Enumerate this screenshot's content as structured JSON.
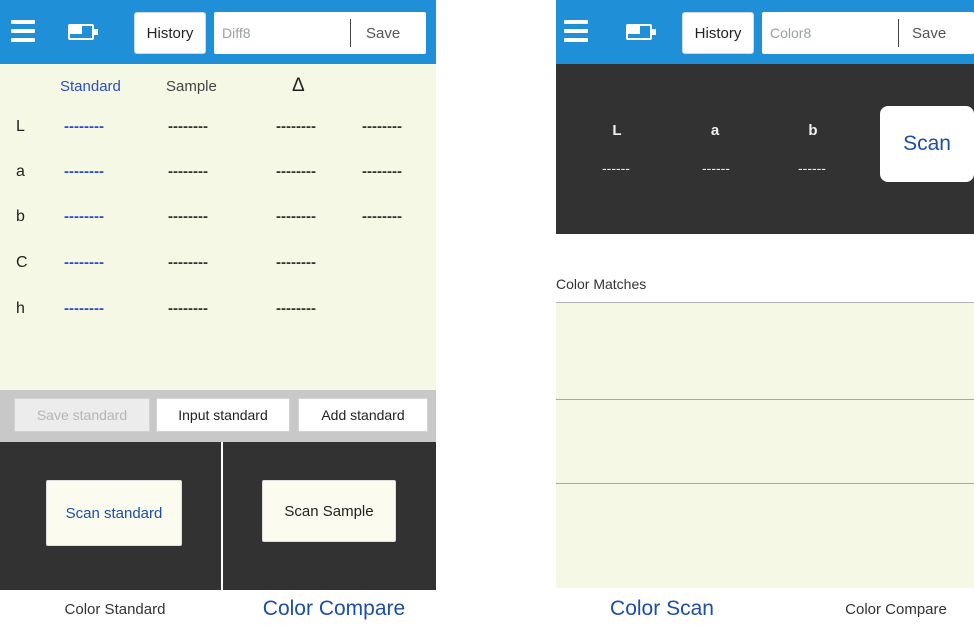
{
  "left": {
    "topbar": {
      "history_label": "History",
      "name_value": "Diff8",
      "save_label": "Save"
    },
    "table": {
      "headers": [
        "Standard",
        "Sample",
        "Δ"
      ],
      "rows": [
        {
          "label": "L",
          "cells": [
            "--------",
            "--------",
            "--------",
            "--------"
          ]
        },
        {
          "label": "a",
          "cells": [
            "--------",
            "--------",
            "--------",
            "--------"
          ]
        },
        {
          "label": "b",
          "cells": [
            "--------",
            "--------",
            "--------",
            "--------"
          ]
        },
        {
          "label": "C",
          "cells": [
            "--------",
            "--------",
            "--------"
          ]
        },
        {
          "label": "h",
          "cells": [
            "--------",
            "--------",
            "--------"
          ]
        }
      ]
    },
    "standard_buttons": {
      "save": "Save standard",
      "input": "Input standard",
      "add": "Add standard"
    },
    "scan": {
      "standard": "Scan standard",
      "sample": "Scan Sample"
    },
    "tabs": {
      "color_standard": "Color Standard",
      "color_compare": "Color Compare"
    }
  },
  "right": {
    "topbar": {
      "history_label": "History",
      "name_value": "Color8",
      "save_label": "Save"
    },
    "lab": {
      "labels": [
        "L",
        "a",
        "b"
      ],
      "values": [
        "------",
        "------",
        "------"
      ]
    },
    "scan_label": "Scan",
    "matches_title": "Color Matches",
    "tabs": {
      "color_scan": "Color Scan",
      "color_compare": "Color Compare"
    }
  },
  "colors": {
    "topbar": "#1f8fd7",
    "panel_bg": "#f6f8e6",
    "dark": "#323232",
    "accent_text": "#1d4ea6",
    "blue_dash": "#2a4cc8"
  }
}
